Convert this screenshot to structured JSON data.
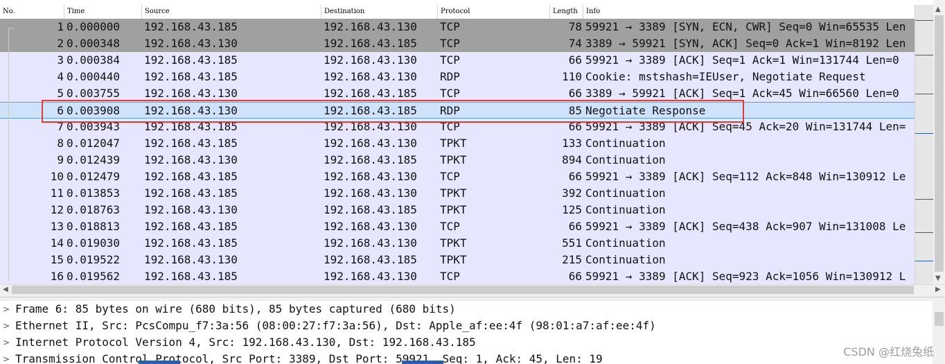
{
  "columns": {
    "no": "No.",
    "time": "Time",
    "source": "Source",
    "destination": "Destination",
    "protocol": "Protocol",
    "length": "Length",
    "info": "Info"
  },
  "packets": [
    {
      "no": "1",
      "time": "0.000000",
      "source": "192.168.43.185",
      "destination": "192.168.43.130",
      "protocol": "TCP",
      "length": "78",
      "info": "59921 → 3389 [SYN, ECN, CWR] Seq=0 Win=65535 Len"
    },
    {
      "no": "2",
      "time": "0.000348",
      "source": "192.168.43.130",
      "destination": "192.168.43.185",
      "protocol": "TCP",
      "length": "74",
      "info": "3389 → 59921 [SYN, ACK] Seq=0 Ack=1 Win=8192 Len"
    },
    {
      "no": "3",
      "time": "0.000384",
      "source": "192.168.43.185",
      "destination": "192.168.43.130",
      "protocol": "TCP",
      "length": "66",
      "info": "59921 → 3389 [ACK] Seq=1 Ack=1 Win=131744 Len=0"
    },
    {
      "no": "4",
      "time": "0.000440",
      "source": "192.168.43.185",
      "destination": "192.168.43.130",
      "protocol": "RDP",
      "length": "110",
      "info": "Cookie: mstshash=IEUser, Negotiate Request"
    },
    {
      "no": "5",
      "time": "0.003755",
      "source": "192.168.43.130",
      "destination": "192.168.43.185",
      "protocol": "TCP",
      "length": "66",
      "info": "3389 → 59921 [ACK] Seq=1 Ack=45 Win=66560 Len=0"
    },
    {
      "no": "6",
      "time": "0.003908",
      "source": "192.168.43.130",
      "destination": "192.168.43.185",
      "protocol": "RDP",
      "length": "85",
      "info": "Negotiate Response"
    },
    {
      "no": "7",
      "time": "0.003943",
      "source": "192.168.43.185",
      "destination": "192.168.43.130",
      "protocol": "TCP",
      "length": "66",
      "info": "59921 → 3389 [ACK] Seq=45 Ack=20 Win=131744 Len="
    },
    {
      "no": "8",
      "time": "0.012047",
      "source": "192.168.43.185",
      "destination": "192.168.43.130",
      "protocol": "TPKT",
      "length": "133",
      "info": "Continuation"
    },
    {
      "no": "9",
      "time": "0.012439",
      "source": "192.168.43.130",
      "destination": "192.168.43.185",
      "protocol": "TPKT",
      "length": "894",
      "info": "Continuation"
    },
    {
      "no": "10",
      "time": "0.012479",
      "source": "192.168.43.185",
      "destination": "192.168.43.130",
      "protocol": "TCP",
      "length": "66",
      "info": "59921 → 3389 [ACK] Seq=112 Ack=848 Win=130912 Le"
    },
    {
      "no": "11",
      "time": "0.013853",
      "source": "192.168.43.185",
      "destination": "192.168.43.130",
      "protocol": "TPKT",
      "length": "392",
      "info": "Continuation"
    },
    {
      "no": "12",
      "time": "0.018763",
      "source": "192.168.43.130",
      "destination": "192.168.43.185",
      "protocol": "TPKT",
      "length": "125",
      "info": "Continuation"
    },
    {
      "no": "13",
      "time": "0.018813",
      "source": "192.168.43.185",
      "destination": "192.168.43.130",
      "protocol": "TCP",
      "length": "66",
      "info": "59921 → 3389 [ACK] Seq=438 Ack=907 Win=131008 Le"
    },
    {
      "no": "14",
      "time": "0.019030",
      "source": "192.168.43.185",
      "destination": "192.168.43.130",
      "protocol": "TPKT",
      "length": "551",
      "info": "Continuation"
    },
    {
      "no": "15",
      "time": "0.019522",
      "source": "192.168.43.130",
      "destination": "192.168.43.185",
      "protocol": "TPKT",
      "length": "215",
      "info": "Continuation"
    },
    {
      "no": "16",
      "time": "0.019562",
      "source": "192.168.43.185",
      "destination": "192.168.43.130",
      "protocol": "TCP",
      "length": "66",
      "info": "59921 → 3389 [ACK] Seq=923 Ack=1056 Win=130912 L"
    }
  ],
  "details": [
    {
      "expander": ">",
      "text": "Frame 6: 85 bytes on wire (680 bits), 85 bytes captured (680 bits)"
    },
    {
      "expander": ">",
      "text": "Ethernet II, Src: PcsCompu_f7:3a:56 (08:00:27:f7:3a:56), Dst: Apple_af:ee:4f (98:01:a7:af:ee:4f)"
    },
    {
      "expander": ">",
      "text": "Internet Protocol Version 4, Src: 192.168.43.130, Dst: 192.168.43.185"
    },
    {
      "expander": ">",
      "text": "Transmission Control Protocol, Src Port: 3389, Dst Port: 59921, Seq: 1, Ack: 45, Len: 19"
    }
  ],
  "watermark": "CSDN @红烧兔纸",
  "icons": {
    "scroll_up": "▲",
    "scroll_down": "▼",
    "scroll_left": "◀",
    "scroll_right": "▶"
  },
  "colors": {
    "row_default": "#e7e6ff",
    "row_gray": "#a0a0a0",
    "row_selected": "#cfe2fb",
    "annotation": "#e53935"
  }
}
